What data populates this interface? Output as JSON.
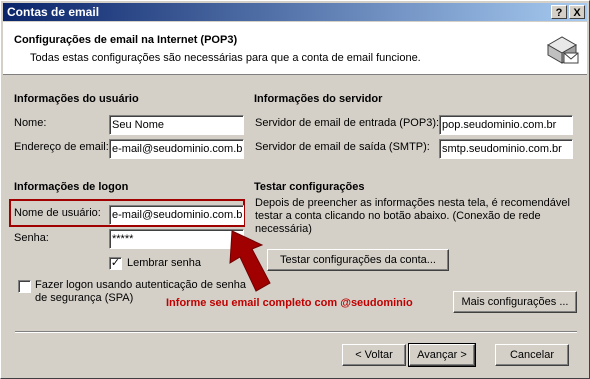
{
  "window": {
    "title": "Contas de email",
    "help_button": "?",
    "close_button": "X"
  },
  "header": {
    "title": "Configurações de email na Internet (POP3)",
    "subtitle": "Todas estas configurações são necessárias para que a conta de email funcione."
  },
  "user_info": {
    "section_title": "Informações do usuário",
    "name_label": "Nome:",
    "name_value": "Seu Nome",
    "email_label": "Endereço de email:",
    "email_value": "e-mail@seudominio.com.br"
  },
  "server_info": {
    "section_title": "Informações do servidor",
    "incoming_label": "Servidor de email de entrada (POP3):",
    "incoming_value": "pop.seudominio.com.br",
    "outgoing_label": "Servidor de email de saída (SMTP):",
    "outgoing_value": "smtp.seudominio.com.br"
  },
  "logon_info": {
    "section_title": "Informações de logon",
    "username_label": "Nome de usuário:",
    "username_value": "e-mail@seudominio.com.br",
    "password_label": "Senha:",
    "password_value": "*****",
    "remember_label": "Lembrar senha",
    "remember_checked": true,
    "spa_label_line1": "Fazer logon usando autenticação de senha",
    "spa_label_line2": "de segurança (SPA)",
    "spa_checked": false
  },
  "test": {
    "section_title": "Testar configurações",
    "description": "Depois de preencher as informações nesta tela, é recomendável testar a conta clicando no botão abaixo. (Conexão de rede necessária)",
    "test_button": "Testar configurações da conta..."
  },
  "annotation": {
    "note": "Informe seu email completo com @seudominio",
    "color": "#c00000"
  },
  "buttons": {
    "more_settings": "Mais configurações ...",
    "back": "< Voltar",
    "next": "Avançar >",
    "cancel": "Cancelar"
  }
}
